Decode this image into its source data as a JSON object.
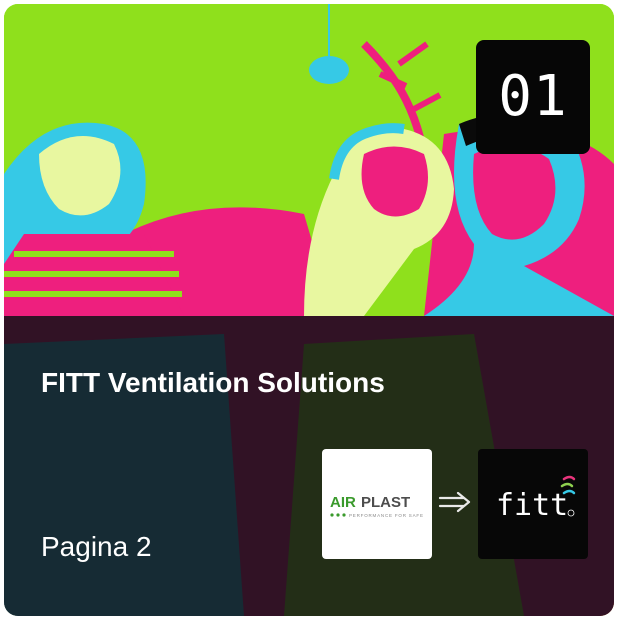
{
  "card": {
    "badge_number": "01",
    "title": "FITT Ventilation Solutions",
    "page_label": "Pagina 2"
  },
  "logos": {
    "from_brand": "AIRPLAST",
    "from_tagline": "PERFORMANCE FOR SAFE",
    "arrow_icon": "double-right-arrow-icon",
    "to_brand": "fitt"
  },
  "colors": {
    "photo_green": "#8fe01c",
    "photo_magenta": "#ee1f7e",
    "photo_cyan": "#36c9e6",
    "overlay": "#121016",
    "airplast_green": "#3a9a2c",
    "airplast_gray": "#4d4d4d",
    "fitt_pink": "#e8347c"
  }
}
